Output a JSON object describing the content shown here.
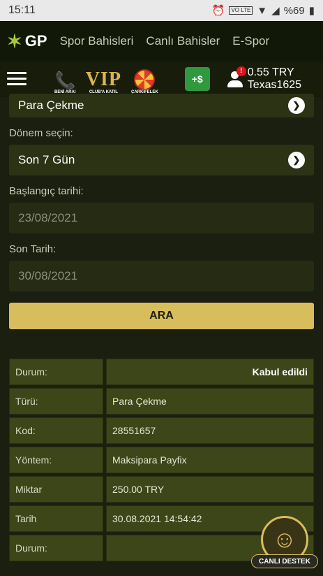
{
  "status_bar": {
    "time": "15:11",
    "lte": "VO LTE",
    "battery": "%69"
  },
  "top_nav": {
    "logo": "GP",
    "links": [
      "Spor Bahisleri",
      "Canlı Bahisler",
      "E-Spor"
    ]
  },
  "second_bar": {
    "promos": [
      {
        "label": "BENİ ARA!"
      },
      {
        "label": "CLUB'A KATIL",
        "text": "VIP"
      },
      {
        "label": "ÇARKIFELEK"
      }
    ],
    "cash_icon": "+$",
    "user": {
      "balance": "0.55 TRY",
      "username": "Texas1625",
      "notification_count": "!"
    }
  },
  "form": {
    "transaction_type": "Para Çekme",
    "period_label": "Dönem seçin:",
    "period_value": "Son 7 Gün",
    "start_label": "Başlangıç tarihi:",
    "start_value": "23/08/2021",
    "end_label": "Son Tarih:",
    "end_value": "30/08/2021",
    "search_label": "ARA"
  },
  "results": [
    {
      "key": "Durum:",
      "value": "Kabul edildi"
    },
    {
      "key": "Türü:",
      "value": "Para Çekme"
    },
    {
      "key": "Kod:",
      "value": "28551657"
    },
    {
      "key": "Yöntem:",
      "value": "Maksipara Payfix"
    },
    {
      "key": "Miktar",
      "value": "250.00 TRY"
    },
    {
      "key": "Tarih",
      "value": "30.08.2021 14:54:42"
    },
    {
      "key": "Durum:",
      "value": ""
    }
  ],
  "support": {
    "label": "CANLI DESTEK"
  }
}
